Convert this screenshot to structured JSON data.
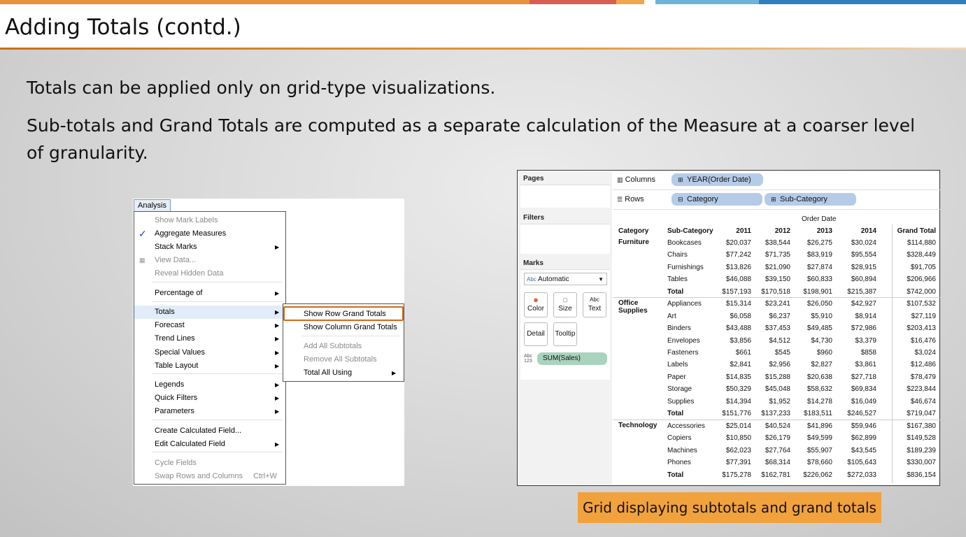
{
  "slide": {
    "title": "Adding Totals (contd.)",
    "bullets": [
      "Totals can be applied only on grid-type visualizations.",
      "Sub-totals and Grand Totals are computed as a separate calculation of the Measure at a coarser level of granularity."
    ],
    "caption": "Grid displaying subtotals and grand totals",
    "accent_colors": [
      "#e8923a",
      "#d85d52",
      "#6fb2d8",
      "#2d7fbf"
    ]
  },
  "analysis_menu": {
    "header": "Analysis",
    "items": [
      {
        "label": "Show Mark Labels",
        "disabled": true
      },
      {
        "label": "Aggregate Measures",
        "checked": true
      },
      {
        "label": "Stack Marks",
        "submenu": true
      },
      {
        "label": "View Data...",
        "disabled": true,
        "icon": "grid-icon"
      },
      {
        "label": "Reveal Hidden Data",
        "disabled": true
      },
      {
        "label": "Percentage of",
        "submenu": true
      },
      {
        "label": "Totals",
        "submenu": true,
        "highlighted": true
      },
      {
        "label": "Forecast",
        "submenu": true
      },
      {
        "label": "Trend Lines",
        "submenu": true
      },
      {
        "label": "Special Values",
        "submenu": true
      },
      {
        "label": "Table Layout",
        "submenu": true
      },
      {
        "label": "Legends",
        "submenu": true
      },
      {
        "label": "Quick Filters",
        "submenu": true
      },
      {
        "label": "Parameters",
        "submenu": true
      },
      {
        "label": "Create Calculated Field..."
      },
      {
        "label": "Edit Calculated Field",
        "submenu": true
      },
      {
        "label": "Cycle Fields",
        "disabled": true
      },
      {
        "label": "Swap Rows and Columns",
        "disabled": true,
        "shortcut": "Ctrl+W"
      }
    ],
    "totals_submenu": [
      {
        "label": "Show Row Grand Totals",
        "highlighted": true
      },
      {
        "label": "Show Column Grand Totals"
      },
      {
        "label": "Add All Subtotals",
        "disabled": true
      },
      {
        "label": "Remove All Subtotals",
        "disabled": true
      },
      {
        "label": "Total All Using",
        "submenu": true
      }
    ]
  },
  "tableau": {
    "cards": {
      "pages": "Pages",
      "filters": "Filters",
      "marks": "Marks"
    },
    "mark_type": "Automatic",
    "mark_type_prefix": "Abc",
    "mark_buttons": [
      "Color",
      "Size",
      "Text",
      "Detail",
      "Tooltip"
    ],
    "measure_pill": "SUM(Sales)",
    "measure_pill_icon": "Abc 123",
    "shelves": {
      "columns_label": "Columns",
      "rows_label": "Rows",
      "columns_pills": [
        "YEAR(Order Date)"
      ],
      "rows_pills": [
        "Category",
        "Sub-Category"
      ]
    },
    "table": {
      "top_header": "Order Date",
      "headers": [
        "Category",
        "Sub-Category",
        "2011",
        "2012",
        "2013",
        "2014",
        "Grand Total"
      ],
      "groups": [
        {
          "category": "Furniture",
          "rows": [
            [
              "Bookcases",
              "$20,037",
              "$38,544",
              "$26,275",
              "$30,024",
              "$114,880"
            ],
            [
              "Chairs",
              "$77,242",
              "$71,735",
              "$83,919",
              "$95,554",
              "$328,449"
            ],
            [
              "Furnishings",
              "$13,826",
              "$21,090",
              "$27,874",
              "$28,915",
              "$91,705"
            ],
            [
              "Tables",
              "$46,088",
              "$39,150",
              "$60,833",
              "$60,894",
              "$206,966"
            ],
            [
              "Total",
              "$157,193",
              "$170,518",
              "$198,901",
              "$215,387",
              "$742,000"
            ]
          ]
        },
        {
          "category": "Office Supplies",
          "rows": [
            [
              "Appliances",
              "$15,314",
              "$23,241",
              "$26,050",
              "$42,927",
              "$107,532"
            ],
            [
              "Art",
              "$6,058",
              "$6,237",
              "$5,910",
              "$8,914",
              "$27,119"
            ],
            [
              "Binders",
              "$43,488",
              "$37,453",
              "$49,485",
              "$72,986",
              "$203,413"
            ],
            [
              "Envelopes",
              "$3,856",
              "$4,512",
              "$4,730",
              "$3,379",
              "$16,476"
            ],
            [
              "Fasteners",
              "$661",
              "$545",
              "$960",
              "$858",
              "$3,024"
            ],
            [
              "Labels",
              "$2,841",
              "$2,956",
              "$2,827",
              "$3,861",
              "$12,486"
            ],
            [
              "Paper",
              "$14,835",
              "$15,288",
              "$20,638",
              "$27,718",
              "$78,479"
            ],
            [
              "Storage",
              "$50,329",
              "$45,048",
              "$58,632",
              "$69,834",
              "$223,844"
            ],
            [
              "Supplies",
              "$14,394",
              "$1,952",
              "$14,278",
              "$16,049",
              "$46,674"
            ],
            [
              "Total",
              "$151,776",
              "$137,233",
              "$183,511",
              "$246,527",
              "$719,047"
            ]
          ]
        },
        {
          "category": "Technology",
          "rows": [
            [
              "Accessories",
              "$25,014",
              "$40,524",
              "$41,896",
              "$59,946",
              "$167,380"
            ],
            [
              "Copiers",
              "$10,850",
              "$26,179",
              "$49,599",
              "$62,899",
              "$149,528"
            ],
            [
              "Machines",
              "$62,023",
              "$27,764",
              "$55,907",
              "$43,545",
              "$189,239"
            ],
            [
              "Phones",
              "$77,391",
              "$68,314",
              "$78,660",
              "$105,643",
              "$330,007"
            ],
            [
              "Total",
              "$175,278",
              "$162,781",
              "$226,062",
              "$272,033",
              "$836,154"
            ]
          ]
        }
      ]
    }
  }
}
